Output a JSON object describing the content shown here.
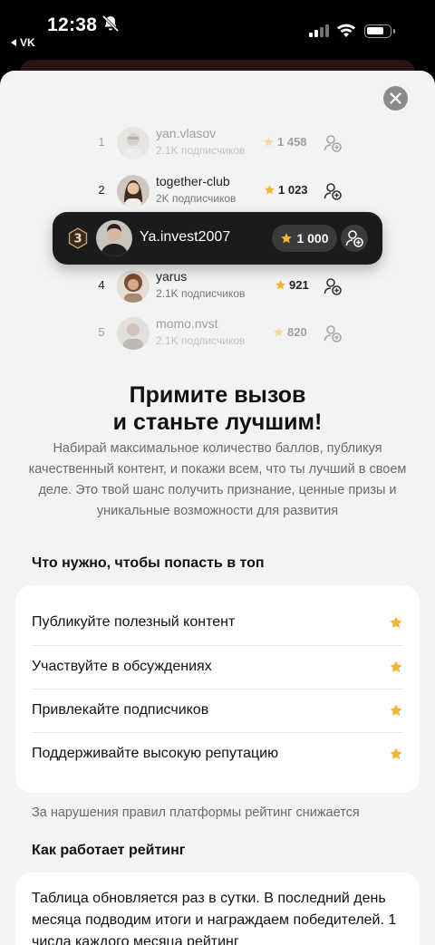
{
  "status_bar": {
    "time": "12:38",
    "back_app": "VK"
  },
  "leaderboard": [
    {
      "rank": "1",
      "name": "yan.vlasov",
      "subscribers": "2.1K подписчиков",
      "score": "1 458",
      "faded": true
    },
    {
      "rank": "2",
      "name": "together-club",
      "subscribers": "2K подписчиков",
      "score": "1 023",
      "faded": false
    },
    {
      "rank": "4",
      "name": "yarus",
      "subscribers": "2.1K подписчиков",
      "score": "921",
      "faded": false
    },
    {
      "rank": "5",
      "name": "momo.nvst",
      "subscribers": "2.1K подписчиков",
      "score": "820",
      "faded": true
    }
  ],
  "highlight": {
    "rank": "3",
    "name": "Ya.invest2007",
    "score": "1 000"
  },
  "hero": {
    "title_line1": "Примите вызов",
    "title_line2": "и станьте лучшим!",
    "description": "Набирай максимальное количество баллов, публикуя качественный контент, и покажи всем, что ты лучший в своем деле. Это твой шанс получить признание, ценные призы и уникальные возможности для развития"
  },
  "requirements": {
    "heading": "Что нужно, чтобы попасть в топ",
    "items": [
      "Публикуйте полезный контент",
      "Участвуйте в обсуждениях",
      "Привлекайте подписчиков",
      "Поддерживайте высокую репутацию"
    ],
    "note": "За нарушения правил платформы рейтинг снижается"
  },
  "rating": {
    "heading": "Как работает рейтинг",
    "text": "Таблица обновляется раз в сутки. В последний день месяца подводим итоги и награждаем победителей. 1 числа каждого месяца рейтинг"
  },
  "colors": {
    "star": "#f2b431",
    "dark_card": "#1b1b1b",
    "sheet_bg": "#f3f3f3"
  }
}
